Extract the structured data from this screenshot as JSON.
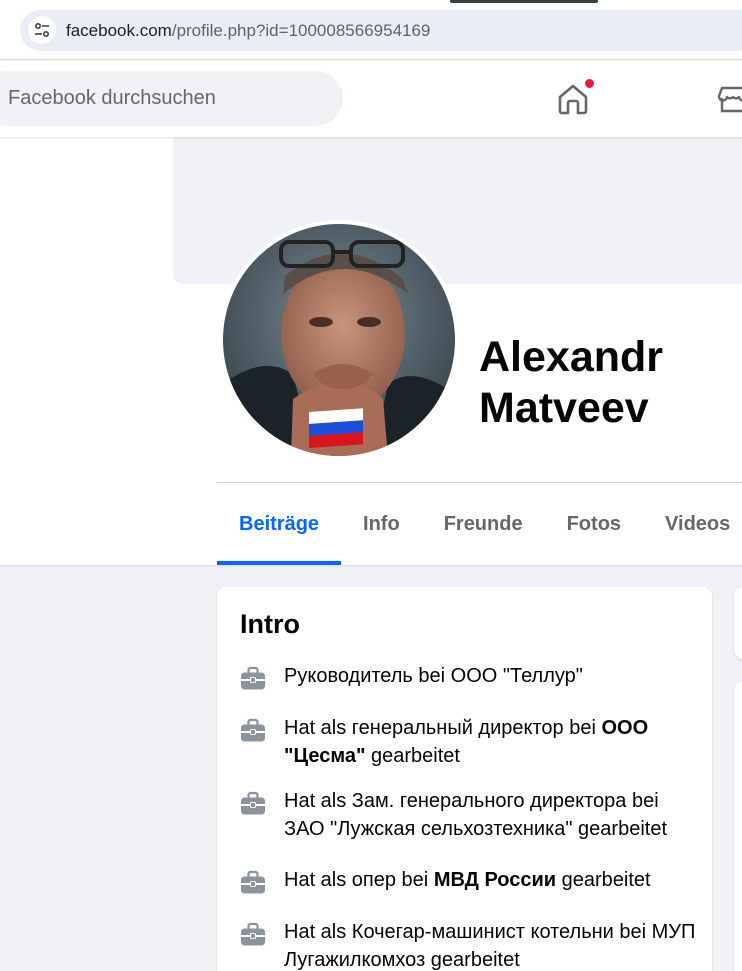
{
  "browser": {
    "url_domain": "facebook.com",
    "url_path": "/profile.php?id=100008566954169",
    "site_info_icon": "tune-icon"
  },
  "nav": {
    "search_placeholder": "Facebook durchsuchen",
    "home_icon": "home-icon",
    "home_notification_color": "#e41e3f",
    "marketplace_icon": "marketplace-icon"
  },
  "profile": {
    "name": "Alexandr Matveev",
    "tabs": [
      "Beiträge",
      "Info",
      "Freunde",
      "Fotos",
      "Videos"
    ],
    "active_tab": "Beiträge"
  },
  "intro": {
    "title": "Intro",
    "items": [
      {
        "prefix": "Руководитель bei ООО \"Теллур\"",
        "bold": "",
        "suffix": ""
      },
      {
        "prefix": "Hat als генеральный директор bei ",
        "bold": "ООО \"Цесма\"",
        "suffix": " gearbeitet"
      },
      {
        "prefix": "Hat als Зам. генерального директора bei ЗАО \"Лужская сельхозтехника\" gearbeitet",
        "bold": "",
        "suffix": ""
      },
      {
        "prefix": "Hat als опер bei ",
        "bold": "МВД России",
        "suffix": " gearbeitet"
      },
      {
        "prefix": "Hat als Кочегар-машинист котельни bei МУП Лугажилкомхоз gearbeitet",
        "bold": "",
        "suffix": ""
      }
    ]
  },
  "colors": {
    "accent": "#0866ff",
    "page_bg": "#f0f2f5",
    "secondary_text": "#65676b"
  }
}
